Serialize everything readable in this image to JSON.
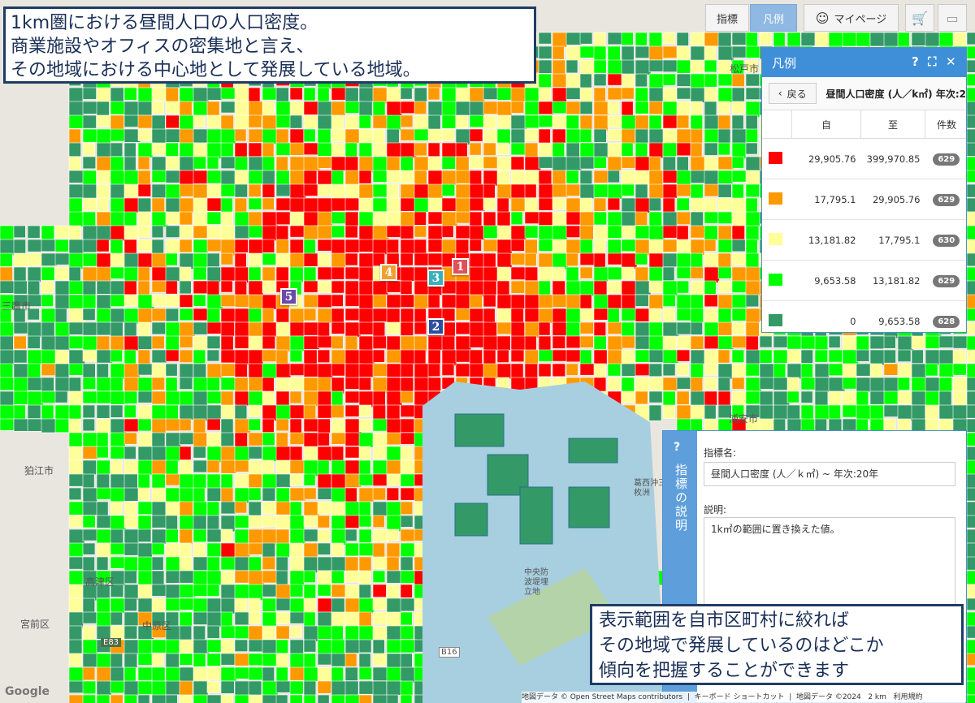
{
  "toolbar": {
    "indicator_label": "指標",
    "legend_label": "凡例",
    "mypage_label": "マイページ"
  },
  "annotation_top": {
    "lines": [
      "1km圏における昼間人口の人口密度。",
      "商業施設やオフィスの密集地と言え、",
      "その地域における中心地として発展している地域。"
    ]
  },
  "annotation_bottom": {
    "lines": [
      "表示範囲を自市区町村に絞れば",
      "その地域で発展しているのはどこか",
      "傾向を把握することができます"
    ]
  },
  "legend": {
    "title": "凡例",
    "back_label": "戻る",
    "indicator_name": "昼間人口密度 (人／k㎡) 年次:2",
    "col_from": "自",
    "col_to": "至",
    "col_count": "件数",
    "rows": [
      {
        "color": "#ff0000",
        "from": "29,905.76",
        "to": "399,970.85",
        "count": "629"
      },
      {
        "color": "#ff9900",
        "from": "17,795.1",
        "to": "29,905.76",
        "count": "629"
      },
      {
        "color": "#ffff99",
        "from": "13,181.82",
        "to": "17,795.1",
        "count": "630"
      },
      {
        "color": "#00ff00",
        "from": "9,653.58",
        "to": "13,181.82",
        "count": "629"
      },
      {
        "color": "#339966",
        "from": "0",
        "to": "9,653.58",
        "count": "628"
      }
    ]
  },
  "description": {
    "side_label": "指標の説明",
    "name_label": "指標名:",
    "name_value": "昼間人口密度 (人／ｋ㎡) ~ 年次:20年",
    "desc_label": "説明:",
    "desc_value": "1k㎡の範囲に置き換えた値。"
  },
  "markers": [
    {
      "num": "1",
      "color": "#e0505a"
    },
    {
      "num": "2",
      "color": "#2e4fa0"
    },
    {
      "num": "3",
      "color": "#3ab0b8"
    },
    {
      "num": "4",
      "color": "#f0a030"
    },
    {
      "num": "5",
      "color": "#6a4aa8"
    }
  ],
  "place_labels": {
    "matsudo": "松戸市",
    "urayasu": "浦安市",
    "mitaka": "三鷹市",
    "komae": "狛江市",
    "takatsu": "高津区",
    "miyamae": "宮前区",
    "nakahara": "中原区",
    "chuo_bouhatei": "中央防波堤埋立地",
    "kasai": "葛西沖三枚洲",
    "e83": "E83",
    "b16": "B16",
    "r357": "357"
  },
  "footer": {
    "google": "Google",
    "attribution": "地図データ © Open Street Maps contributors",
    "shortcuts": "キーボード ショートカット",
    "mapdata": "地図データ ©2024",
    "scale": "2 km",
    "terms": "利用規約"
  }
}
